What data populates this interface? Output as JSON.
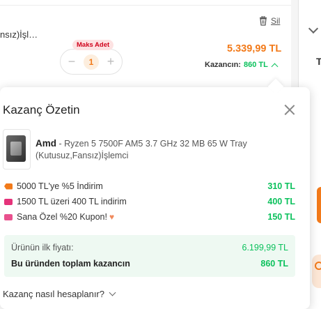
{
  "cart": {
    "product_name": "nsız)İşl…",
    "delete_label": "Sil",
    "max_badge": "Maks Adet",
    "minus": "−",
    "quantity": "1",
    "plus": "+",
    "price": "5.339,99 TL",
    "gain_label": "Kazancın:",
    "gain_value": "860 TL",
    "right_panel_letter": "T"
  },
  "popover": {
    "title": "Kazanç Özetin",
    "brand": "Amd",
    "product_desc": "- Ryzen 5 7500F AM5 3.7 GHz 32 MB 65 W Tray (Kutusuz,Fansız)İşlemci",
    "discounts": [
      {
        "label": "5000 TL'ye %5 İndirim",
        "value": "310 TL",
        "icon": "tag-icon"
      },
      {
        "label": "1500 TL üzeri 400 TL indirim",
        "value": "400 TL",
        "icon": "ticket-icon"
      },
      {
        "label": "Sana Özel %20 Kupon!",
        "value": "150 TL",
        "icon": "coupon-icon"
      }
    ],
    "original_price_label": "Ürünün ilk fiyatı:",
    "original_price": "6.199,99 TL",
    "total_gain_label": "Bu üründen toplam kazancın",
    "total_gain": "860 TL",
    "howto_label": "Kazanç nasıl hesaplanır?"
  },
  "colors": {
    "accent": "#f27a1a",
    "gain_green": "#0bc15c",
    "badge_red": "#d0021b",
    "summary_bg": "#eef9f2"
  }
}
